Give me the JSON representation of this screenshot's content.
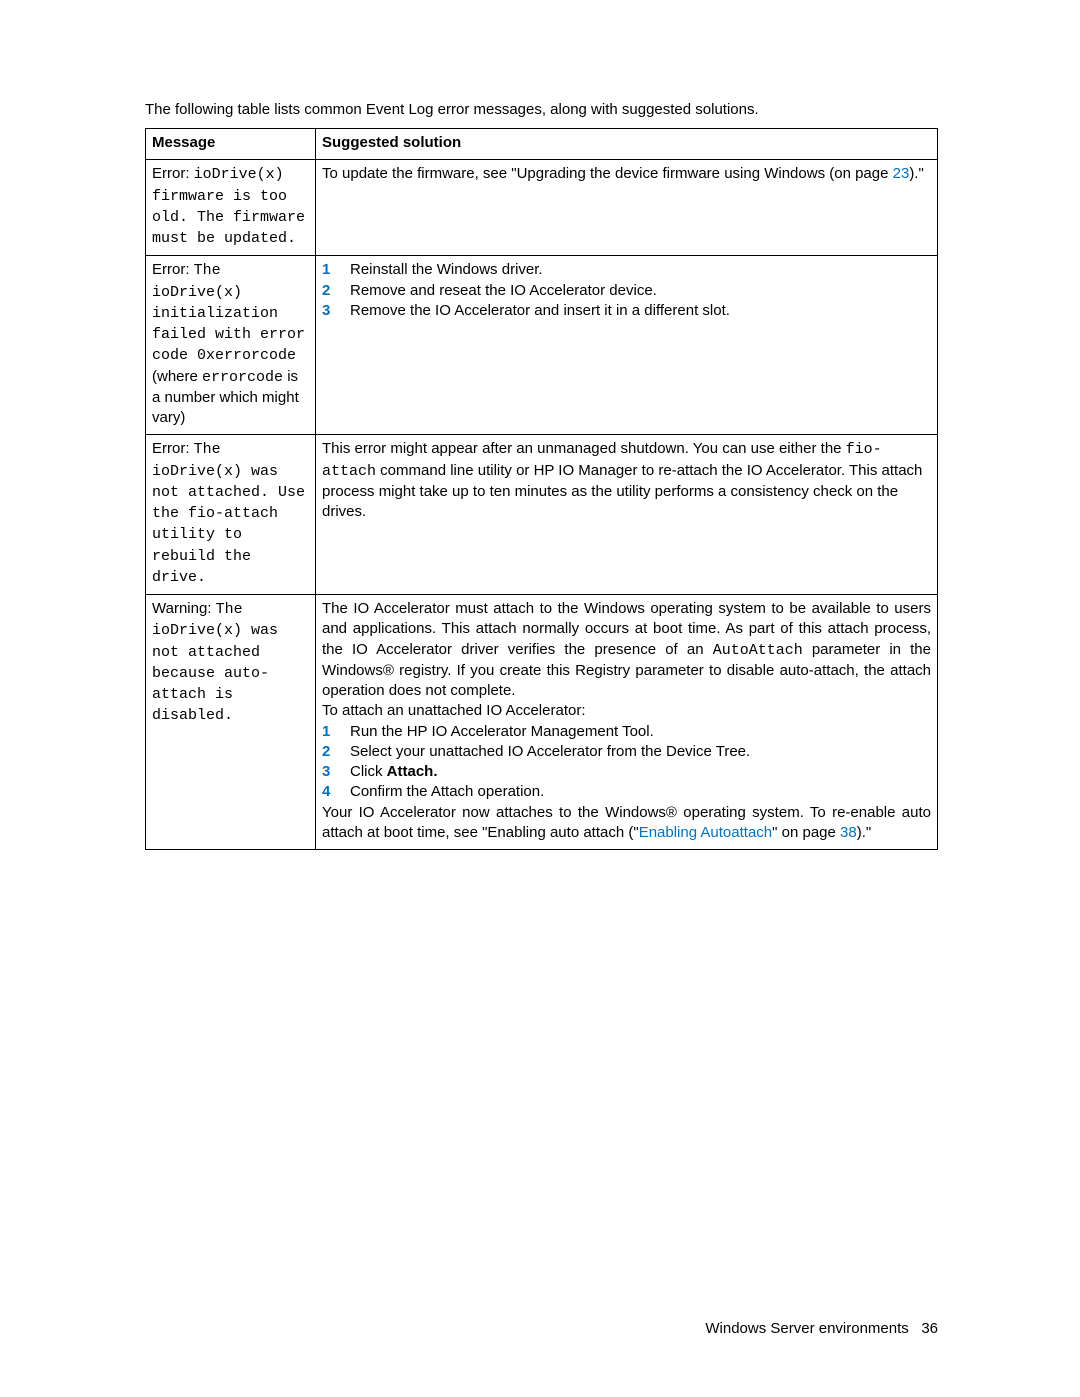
{
  "intro": "The following table lists common Event Log error messages, along with suggested solutions.",
  "headers": {
    "message": "Message",
    "solution": "Suggested solution"
  },
  "row1": {
    "prefix": "Error: ",
    "code": "ioDrive(x) firmware is too old. The firmware must be updated.",
    "sol_a": "To update the firmware, see \"Upgrading the device firmware using Windows (on page ",
    "sol_link": "23",
    "sol_b": ").\""
  },
  "row2": {
    "prefix": "Error: ",
    "code1": "The ioDrive(x) initialization failed with error code 0xerrorcode",
    "plain1": " (where ",
    "code2": "errorcode",
    "plain2": " is a number which might vary)",
    "step1": "Reinstall the Windows driver.",
    "step2": "Remove and reseat the IO Accelerator device.",
    "step3": "Remove the IO Accelerator and insert it in a different slot."
  },
  "row3": {
    "prefix": "Error: ",
    "code": "The ioDrive(x) was not attached. Use the fio-attach utility to rebuild the drive.",
    "sol_a": "This error might appear after an unmanaged shutdown. You can use either the ",
    "sol_code": "fio-attach",
    "sol_b": " command line utility or HP IO Manager to re-attach the IO Accelerator. This attach process might take up to ten minutes as the utility performs a consistency check on the drives."
  },
  "row4": {
    "prefix": "Warning: ",
    "code": "The ioDrive(x) was not attached because auto-attach is disabled.",
    "p1a": "The IO Accelerator must attach to the Windows operating system to be available to users and applications. This attach normally occurs at boot time. As part of this attach process, the IO Accelerator driver verifies the presence of an ",
    "p1code": "AutoAttach",
    "p1b": " parameter in the Windows® registry. If you create this Registry parameter to disable auto-attach, the attach operation does not complete.",
    "p2": "To attach an unattached IO Accelerator:",
    "step1": "Run the HP IO Accelerator Management Tool.",
    "step2": "Select your unattached IO Accelerator from the Device Tree.",
    "step3_a": "Click ",
    "step3_b": "Attach.",
    "step4": "Confirm the Attach operation.",
    "p3a": "Your IO Accelerator now attaches to the Windows® operating system. To re-enable auto attach at boot time, see \"Enabling auto attach (\"",
    "p3link": "Enabling Autoattach",
    "p3b": "\" on page ",
    "p3page": "38",
    "p3c": ").\""
  },
  "footer": {
    "section": "Windows Server environments",
    "page": "36"
  }
}
